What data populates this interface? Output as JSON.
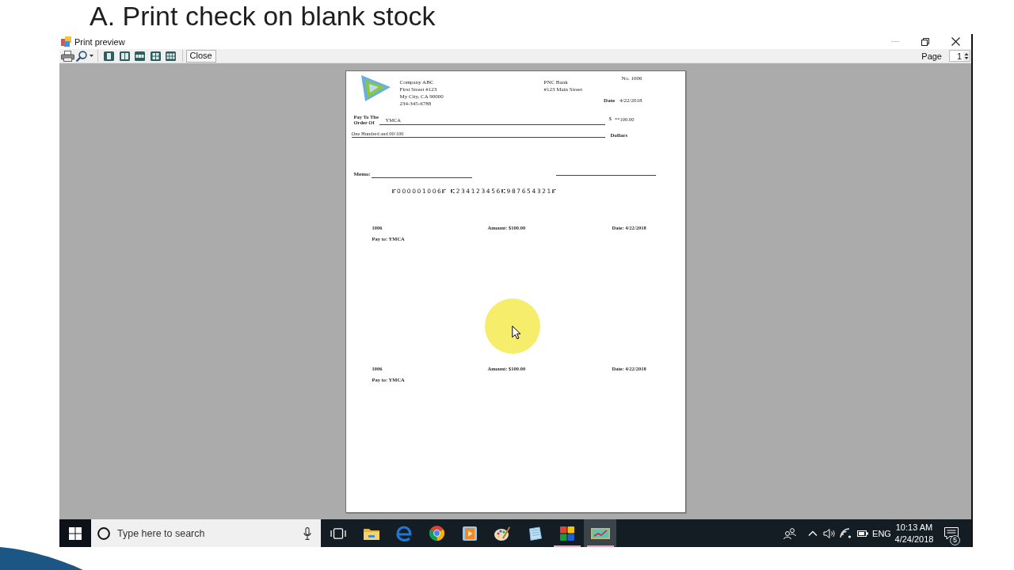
{
  "slide": {
    "title": "A. Print check on blank stock"
  },
  "window": {
    "title": "Print preview",
    "controls": [
      {
        "kind": "minimize",
        "disabled": true
      },
      {
        "kind": "restore",
        "disabled": false
      },
      {
        "kind": "close",
        "disabled": false
      }
    ]
  },
  "toolbar": {
    "close_button": "Close",
    "page_label": "Page",
    "page_value": "1"
  },
  "check": {
    "company": {
      "name": "Company ABC",
      "street": "First Street #123",
      "city": "My City, CA 90000",
      "phone": "234-345-6788"
    },
    "bank": {
      "name": "PNC Bank",
      "street": "#123 Main Street"
    },
    "number": "No. 1006",
    "date_label": "Date",
    "date": "4/22/2018",
    "pay_to_label": [
      "Pay To The",
      "Order Of"
    ],
    "payee": "YMCA",
    "currency": "$",
    "amount": "**100.00",
    "amount_in_words": "One Hundred and 00/100",
    "dollars_label": "Dollars",
    "memo_label": "Memo:",
    "micr_line": "⑈000001006⑈ ⑆234123456⑆987654321⑈"
  },
  "stubs": [
    {
      "number": "1006",
      "amount": "Amount: $100.00",
      "date": "Date: 4/22/2018",
      "pay_to": "Pay to: YMCA"
    },
    {
      "number": "1006",
      "amount": "Amount: $100.00",
      "date": "Date: 4/22/2018",
      "pay_to": "Pay to: YMCA"
    }
  ],
  "taskbar": {
    "search": {
      "placeholder": "Type here to search"
    },
    "apps": [
      {
        "running": false,
        "selected": false
      },
      {
        "running": false,
        "selected": false
      },
      {
        "running": false,
        "selected": false
      },
      {
        "running": false,
        "selected": false
      },
      {
        "running": false,
        "selected": false
      },
      {
        "running": false,
        "selected": false
      },
      {
        "running": true,
        "selected": false
      },
      {
        "running": true,
        "selected": true
      }
    ],
    "language": "ENG",
    "time": "10:13 AM",
    "date": "4/24/2018",
    "notification_count": "5"
  }
}
